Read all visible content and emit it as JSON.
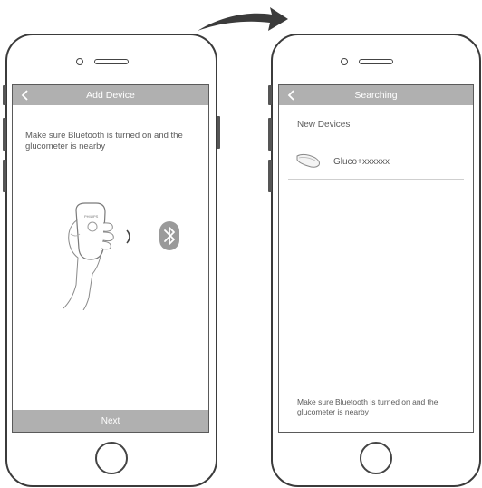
{
  "left_screen": {
    "title": "Add Device",
    "instruction_line1": "Make sure Bluetooth is turned on and the",
    "instruction_line2": "glucometer is nearby",
    "next_label": "Next",
    "device_brand": "PHILIPS",
    "icons": [
      "back-chevron-icon",
      "hand-holding-glucometer",
      "signal-wave-icon",
      "bluetooth-icon"
    ]
  },
  "right_screen": {
    "title": "Searching",
    "section_label": "New Devices",
    "device_name": "Gluco+xxxxxx",
    "hint_line1": "Make sure Bluetooth is turned on and the",
    "hint_line2": "glucometer is nearby",
    "icons": [
      "back-chevron-icon",
      "glucometer-thumbnail-icon"
    ]
  },
  "transition": {
    "icon": "arrow-right-icon"
  },
  "colors": {
    "bar": "#b0b0b0",
    "text": "#5b5b5b",
    "outline": "#3b3b3b",
    "bluetooth": "#9a9a9a"
  }
}
